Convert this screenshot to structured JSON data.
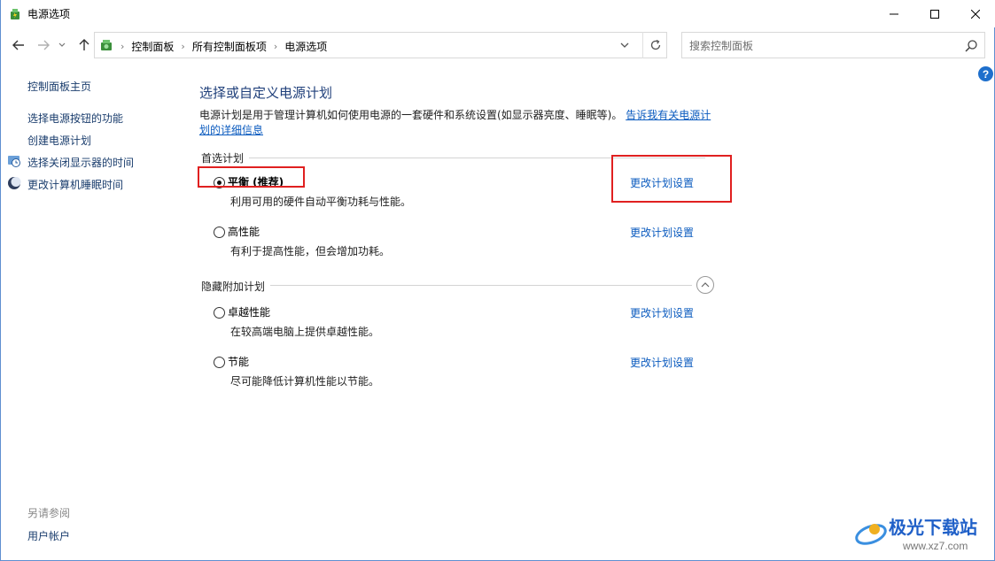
{
  "window": {
    "title": "电源选项"
  },
  "address": {
    "crumbs": [
      "控制面板",
      "所有控制面板项",
      "电源选项"
    ]
  },
  "search": {
    "placeholder": "搜索控制面板"
  },
  "help_label": "?",
  "left_panel": {
    "home": "控制面板主页",
    "links": [
      "选择电源按钮的功能",
      "创建电源计划",
      "选择关闭显示器的时间",
      "更改计算机睡眠时间"
    ],
    "see_also": "另请参阅",
    "user_accounts": "用户帐户"
  },
  "main": {
    "title": "选择或自定义电源计划",
    "description": "电源计划是用于管理计算机如何使用电源的一套硬件和系统设置(如显示器亮度、睡眠等)。",
    "learn_more": "告诉我有关电源计划的详细信息",
    "preferred_section": "首选计划",
    "hidden_section": "隐藏附加计划",
    "change_label": "更改计划设置",
    "plans": [
      {
        "name": "平衡 (推荐)",
        "desc": "利用可用的硬件自动平衡功耗与性能。",
        "selected": true
      },
      {
        "name": "高性能",
        "desc": "有利于提高性能，但会增加功耗。",
        "selected": false
      },
      {
        "name": "卓越性能",
        "desc": "在较高端电脑上提供卓越性能。",
        "selected": false
      },
      {
        "name": "节能",
        "desc": "尽可能降低计算机性能以节能。",
        "selected": false
      }
    ]
  },
  "watermark": {
    "text": "极光下载站",
    "url": "www.xz7.com"
  },
  "colors": {
    "link": "#0b5bbf",
    "highlight": "#e02020",
    "title": "#1f3f7a"
  }
}
